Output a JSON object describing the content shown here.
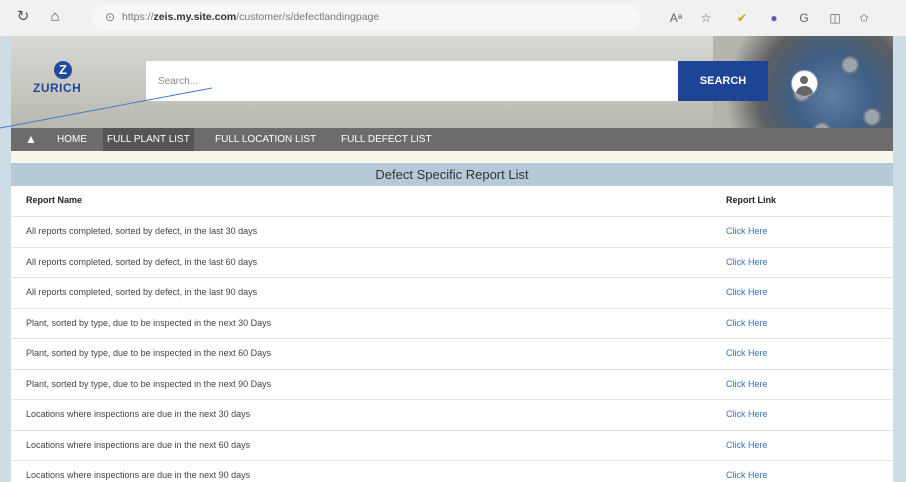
{
  "browser": {
    "url_prefix": "https://",
    "url_host": "zeis.my.site.com",
    "url_path": "/customer/s/defectlandingpage"
  },
  "brand": {
    "logo_letter": "Z",
    "logo_text": "ZURICH"
  },
  "search": {
    "placeholder": "Search...",
    "button_label": "SEARCH"
  },
  "nav": {
    "home": "HOME",
    "plant": "FULL PLANT LIST",
    "location": "FULL LOCATION LIST",
    "defect": "FULL DEFECT LIST"
  },
  "report": {
    "title": "Defect Specific Report List",
    "col_name": "Report Name",
    "col_link": "Report Link",
    "rows": [
      {
        "name": "All reports completed, sorted by defect, in the last 30 days",
        "link": "Click Here"
      },
      {
        "name": "All reports completed, sorted by defect, in the last 60 days",
        "link": "Click Here"
      },
      {
        "name": "All reports completed, sorted by defect, in the last 90 days",
        "link": "Click Here"
      },
      {
        "name": "Plant, sorted by type, due to be inspected in the next 30 Days",
        "link": "Click Here"
      },
      {
        "name": "Plant, sorted by type, due to be inspected in the next 60 Days",
        "link": "Click Here"
      },
      {
        "name": "Plant, sorted by type, due to be inspected in the next 90 Days",
        "link": "Click Here"
      },
      {
        "name": "Locations where inspections are due in the next 30 days",
        "link": "Click Here"
      },
      {
        "name": "Locations where inspections are due in the next 60 days",
        "link": "Click Here"
      },
      {
        "name": "Locations where inspections are due in the next 90 days",
        "link": "Click Here"
      }
    ]
  },
  "colors": {
    "brand_blue": "#1d4495",
    "link_blue": "#3b6fc2",
    "title_band": "#b6c9d6"
  }
}
